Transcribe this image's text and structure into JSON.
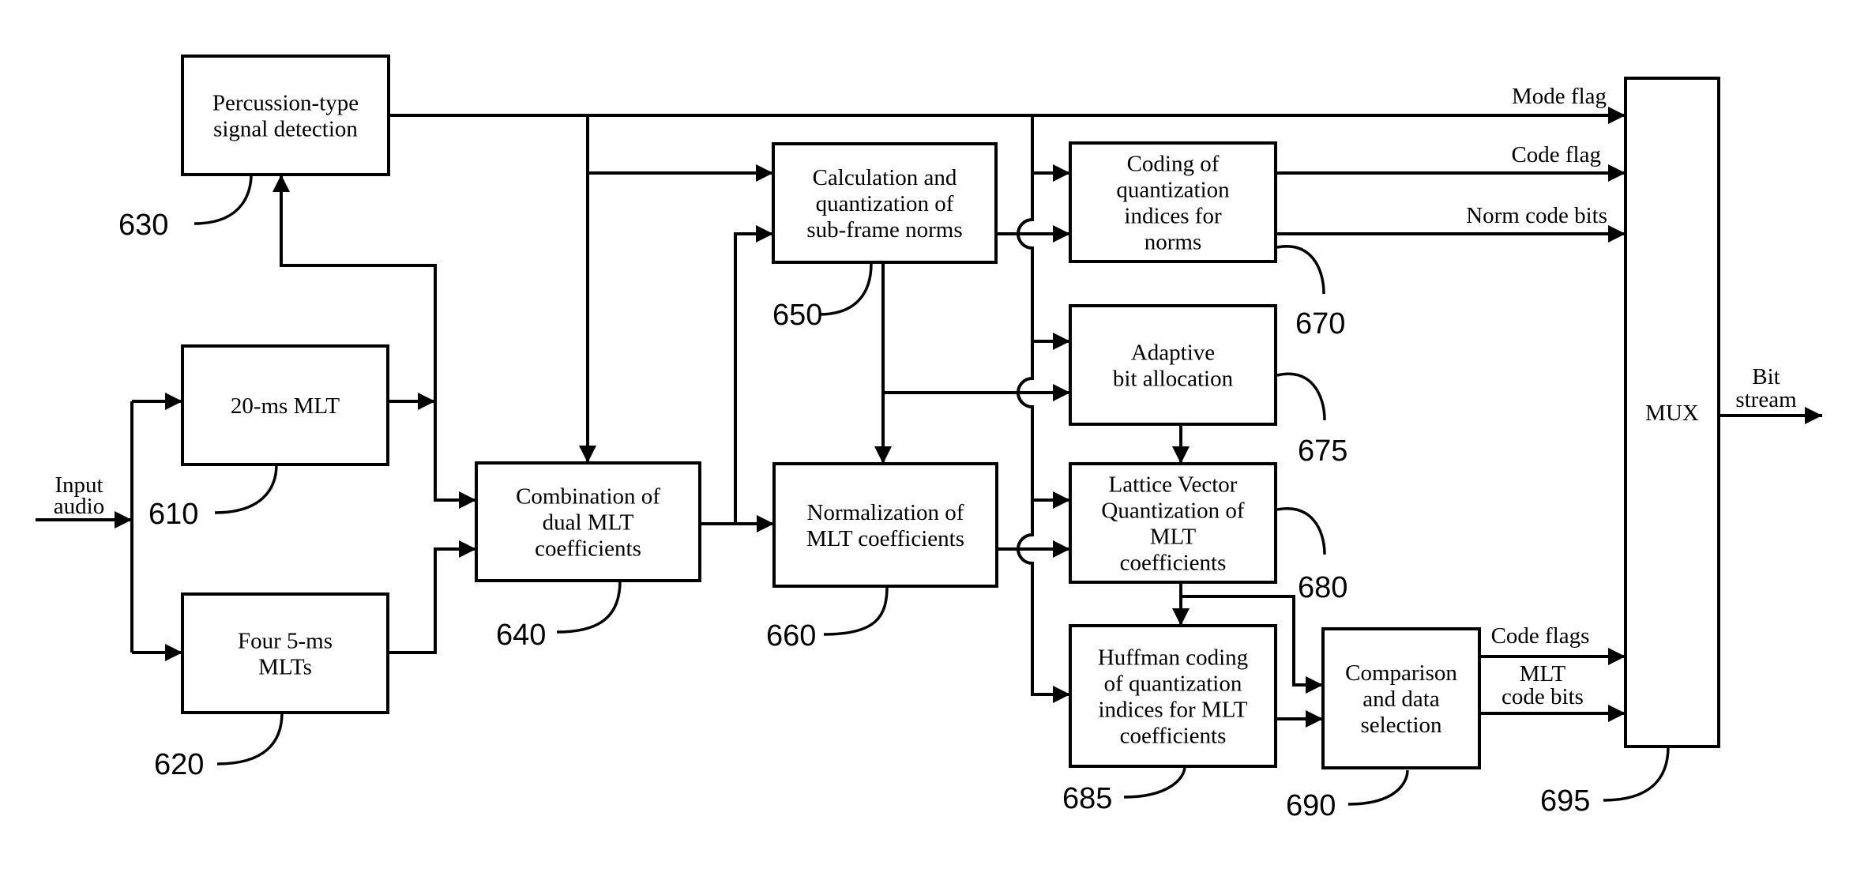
{
  "figure": {
    "blocks": [
      {
        "id": "630",
        "name": "percussion-detection",
        "lines": [
          "Percussion-type",
          "signal detection"
        ]
      },
      {
        "id": "610",
        "name": "mlt-20ms",
        "lines": [
          "20-ms MLT"
        ]
      },
      {
        "id": "620",
        "name": "mlt-5ms",
        "lines": [
          "Four 5-ms",
          "MLTs"
        ]
      },
      {
        "id": "640",
        "name": "combination",
        "lines": [
          "Combination of",
          "dual MLT",
          "coefficients"
        ]
      },
      {
        "id": "650",
        "name": "norm-calc",
        "lines": [
          "Calculation and",
          "quantization of",
          "sub-frame norms"
        ]
      },
      {
        "id": "660",
        "name": "normalization",
        "lines": [
          "Normalization of",
          "MLT coefficients"
        ]
      },
      {
        "id": "670",
        "name": "norm-coding",
        "lines": [
          "Coding of",
          "quantization",
          "indices for",
          "norms"
        ]
      },
      {
        "id": "675",
        "name": "bit-allocation",
        "lines": [
          "Adaptive",
          "bit allocation"
        ]
      },
      {
        "id": "680",
        "name": "lattice-vq",
        "lines": [
          "Lattice Vector",
          "Quantization of",
          "MLT",
          "coefficients"
        ]
      },
      {
        "id": "685",
        "name": "huffman-coding",
        "lines": [
          "Huffman coding",
          "of quantization",
          "indices for MLT",
          "coefficients"
        ]
      },
      {
        "id": "690",
        "name": "comparison",
        "lines": [
          "Comparison",
          "and data",
          "selection"
        ]
      },
      {
        "id": "695",
        "name": "mux",
        "lines": [
          "MUX"
        ]
      }
    ],
    "signals": {
      "input": [
        "Input",
        "audio"
      ],
      "mode_flag": "Mode flag",
      "code_flag": "Code flag",
      "norm_code_bits": "Norm code bits",
      "code_flags": "Code flags",
      "mlt_code_bits": [
        "MLT",
        "code bits"
      ],
      "bit_stream": [
        "Bit",
        "stream"
      ]
    }
  }
}
